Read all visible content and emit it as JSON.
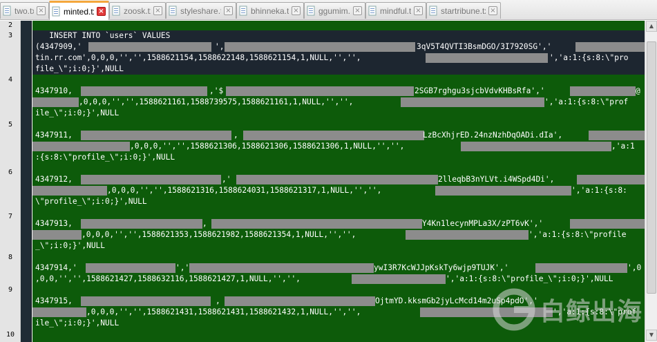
{
  "tabs": [
    {
      "label": "two.txt",
      "active": false
    },
    {
      "label": "minted.txt",
      "active": true
    },
    {
      "label": "zoosk.txt",
      "active": false
    },
    {
      "label": "styleshare.txt",
      "active": false
    },
    {
      "label": "bhinneka.txt",
      "active": false
    },
    {
      "label": "ggumim.txt",
      "active": false
    },
    {
      "label": "mindful.txt",
      "active": false
    },
    {
      "label": "startribune.txt",
      "active": false
    }
  ],
  "tab_close_symbol": "×",
  "line_numbers": [
    "2",
    "3",
    "4",
    "5",
    "6",
    "7",
    "8",
    "9",
    "10"
  ],
  "code": {
    "l3a": "   INSERT INTO `users` VALUES",
    "l3b_a": "(4347909,'",
    "l3b_b": "',",
    "l3b_c": "3qV5T4QVTI3BsmDGO/3I7920SG','",
    "l3c_a": "tin.rr.com',0,0,0,'','',1588621154,1588622148,1588621154,1,NULL,'','',",
    "l3c_b": "','a:1:{s:8:\\\"pro",
    "l3d": "file_\\\";i:0;}',NULL",
    "l4a_a": "4347910,",
    "l4a_b": ",'$",
    "l4a_c": "2SGB7rghgu3sjcbVdvKHBsRfa','",
    "l4a_d": "@",
    "l4b_a": ",0,0,0,'','',1588621161,1588739575,1588621161,1,NULL,'','',",
    "l4b_b": "','a:1:{s:8:\\\"prof",
    "l4c": "ile_\\\";i:0;}',NULL",
    "l5a_a": "4347911,",
    "l5a_b": ",",
    "l5a_c": "LzBcXhjrED.24nzNzhDqOADi.dIa',",
    "l5b_a": ",0,0,0,'','',1588621306,1588621306,1588621306,1,NULL,'','',",
    "l5b_b": ",'a:1",
    "l5c": ":{s:8:\\\"profile_\\\";i:0;}',NULL",
    "l6a_a": "4347912,",
    "l6a_b": ",'",
    "l6a_c": "2lleqbB3nYLVt.i4WSpd4Di',",
    "l6b_a": ",0,0,0,'','',1588621316,1588624031,1588621317,1,NULL,'','',",
    "l6b_b": "','a:1:{s:8:",
    "l6c": "\\\"profile_\\\";i:0;}',NULL",
    "l7a_a": "4347913,",
    "l7a_b": ",",
    "l7a_c": "Y4Kn1lecynMPLa3X/zPT6vK','",
    "l7b_a": ",0,0,0,'','',1588621353,1588621982,1588621354,1,NULL,'','',",
    "l7b_b": "','a:1:{s:8:\\\"profile",
    "l7c": "_\\\";i:0;}',NULL",
    "l8a_a": "4347914,'",
    "l8a_b": "','",
    "l8a_c": "ywI3R7KcWJJpKskTy6wjp9TUJK','",
    "l8a_d": "',0",
    "l8b_a": ",0,0,'','',1588621427,1588632116,1588621427,1,NULL,'','',",
    "l8b_b": "','a:1:{s:8:\\\"profile_\\\";i:0;}',NULL",
    "l9a_a": "4347915,",
    "l9a_b": ",",
    "l9a_c": "OjtmYD.kksmGb2jyLcMcd14m2uSp4pdO','",
    "l9b_a": ",0,0,0,'','',1588621431,1588621431,1588621432,1,NULL,'','',",
    "l9b_b": "','a:1:{s:8:\\\"prof",
    "l9c": "ile_\\\";i:0;}',NULL"
  },
  "watermark": {
    "text": "白鲸出海"
  },
  "colors": {
    "editor_bg": "#0d5b0a",
    "current_line_bg": "#1d2630",
    "redaction": "#8c8c8c",
    "active_tab_accent": "#f4a73b"
  }
}
